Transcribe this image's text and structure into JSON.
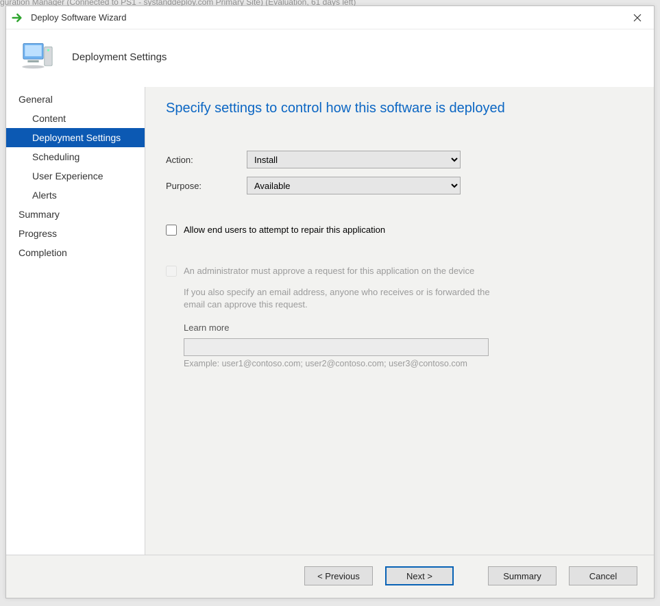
{
  "backdrop_text": "guration Manager (Connected to PS1 - systanddeploy.com Primary Site) (Evaluation, 61 days left)",
  "window": {
    "title": "Deploy Software Wizard"
  },
  "header": {
    "title": "Deployment Settings"
  },
  "sidebar": {
    "items": [
      {
        "label": "General",
        "indent": false
      },
      {
        "label": "Content",
        "indent": true
      },
      {
        "label": "Deployment Settings",
        "indent": true,
        "selected": true
      },
      {
        "label": "Scheduling",
        "indent": true
      },
      {
        "label": "User Experience",
        "indent": true
      },
      {
        "label": "Alerts",
        "indent": true
      },
      {
        "label": "Summary",
        "indent": false
      },
      {
        "label": "Progress",
        "indent": false
      },
      {
        "label": "Completion",
        "indent": false
      }
    ]
  },
  "page": {
    "title": "Specify settings to control how this software is deployed",
    "action_label": "Action:",
    "action_value": "Install",
    "purpose_label": "Purpose:",
    "purpose_value": "Available",
    "cb_repair_label": "Allow end users to attempt to repair this application",
    "cb_approve_label": "An administrator must approve a request for this application on the device",
    "hint_text": "If you also specify an email address, anyone who receives or is forwarded the email can approve this request.",
    "learn_more_label": "Learn more",
    "email_placeholder": "",
    "example_text": "Example: user1@contoso.com; user2@contoso.com; user3@contoso.com"
  },
  "footer": {
    "previous": "< Previous",
    "next": "Next >",
    "summary": "Summary",
    "cancel": "Cancel"
  }
}
